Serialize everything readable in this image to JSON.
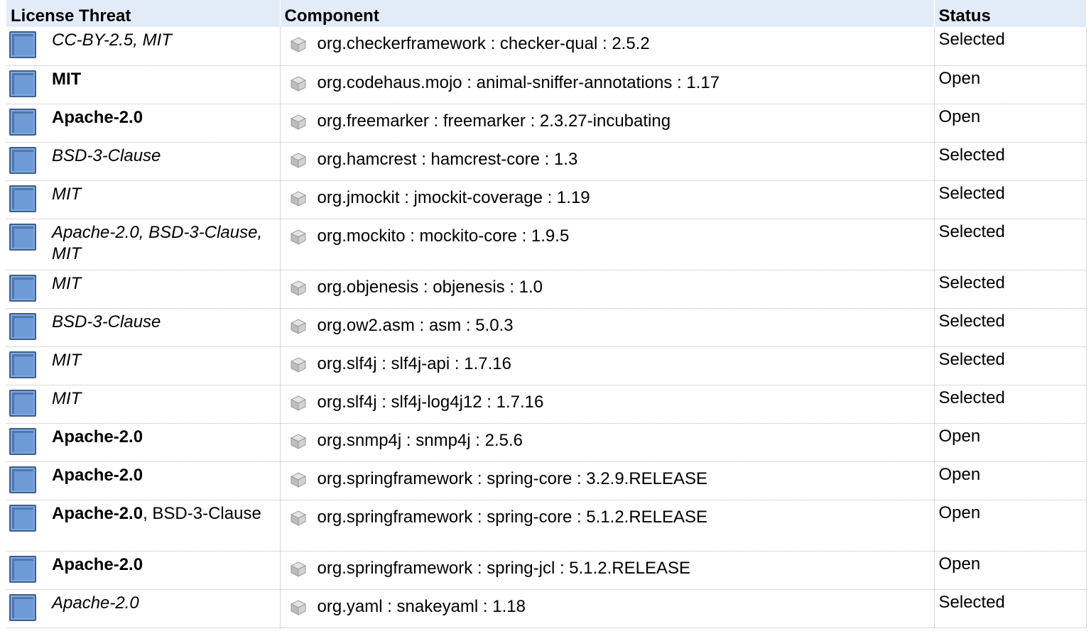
{
  "table": {
    "headers": [
      "License Threat",
      "Component",
      "Status"
    ],
    "rows": [
      {
        "license": [
          {
            "text": "CC-BY-2.5, MIT",
            "style": "italic"
          }
        ],
        "component": "org.checkerframework : checker-qual : 2.5.2",
        "status": "Selected"
      },
      {
        "license": [
          {
            "text": "MIT",
            "style": "bold"
          }
        ],
        "component": "org.codehaus.mojo : animal-sniffer-annotations : 1.17",
        "status": "Open"
      },
      {
        "license": [
          {
            "text": "Apache-2.0",
            "style": "bold"
          }
        ],
        "component": "org.freemarker : freemarker : 2.3.27-incubating",
        "status": "Open"
      },
      {
        "license": [
          {
            "text": "BSD-3-Clause",
            "style": "italic"
          }
        ],
        "component": "org.hamcrest : hamcrest-core : 1.3",
        "status": "Selected"
      },
      {
        "license": [
          {
            "text": "MIT",
            "style": "italic"
          }
        ],
        "component": "org.jmockit : jmockit-coverage : 1.19",
        "status": "Selected"
      },
      {
        "license": [
          {
            "text": "Apache-2.0, BSD-3-Clause, MIT",
            "style": "italic"
          }
        ],
        "component": "org.mockito : mockito-core : 1.9.5",
        "status": "Selected",
        "tall": true
      },
      {
        "license": [
          {
            "text": "MIT",
            "style": "italic"
          }
        ],
        "component": "org.objenesis : objenesis : 1.0",
        "status": "Selected"
      },
      {
        "license": [
          {
            "text": "BSD-3-Clause",
            "style": "italic"
          }
        ],
        "component": "org.ow2.asm : asm : 5.0.3",
        "status": "Selected"
      },
      {
        "license": [
          {
            "text": "MIT",
            "style": "italic"
          }
        ],
        "component": "org.slf4j : slf4j-api : 1.7.16",
        "status": "Selected"
      },
      {
        "license": [
          {
            "text": "MIT",
            "style": "italic"
          }
        ],
        "component": "org.slf4j : slf4j-log4j12 : 1.7.16",
        "status": "Selected"
      },
      {
        "license": [
          {
            "text": "Apache-2.0",
            "style": "bold"
          }
        ],
        "component": "org.snmp4j : snmp4j : 2.5.6",
        "status": "Open"
      },
      {
        "license": [
          {
            "text": "Apache-2.0",
            "style": "bold"
          }
        ],
        "component": "org.springframework : spring-core : 3.2.9.RELEASE",
        "status": "Open"
      },
      {
        "license": [
          {
            "text": "Apache-2.0",
            "style": "bold"
          },
          {
            "text": ", BSD-3-Clause",
            "style": "normal"
          }
        ],
        "component": "org.springframework : spring-core : 5.1.2.RELEASE",
        "status": "Open",
        "tall": true
      },
      {
        "license": [
          {
            "text": "Apache-2.0",
            "style": "bold"
          }
        ],
        "component": "org.springframework : spring-jcl : 5.1.2.RELEASE",
        "status": "Open"
      },
      {
        "license": [
          {
            "text": "Apache-2.0",
            "style": "italic"
          }
        ],
        "component": "org.yaml : snakeyaml : 1.18",
        "status": "Selected"
      }
    ]
  },
  "icons": {
    "threat": "threat-level-square-icon",
    "component": "component-cube-icon"
  },
  "colors": {
    "header_bg": "#e2ecf9",
    "threat_square": "#6e9bd6"
  }
}
